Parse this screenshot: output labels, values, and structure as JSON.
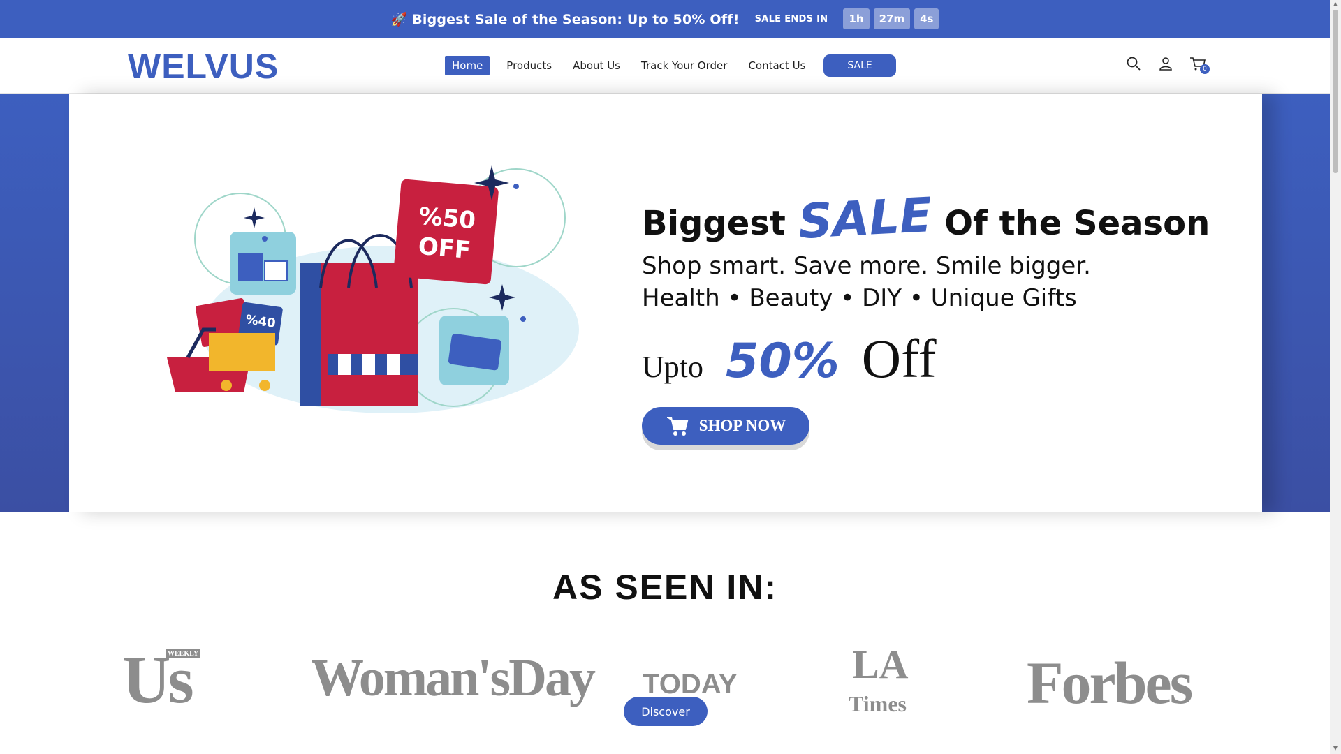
{
  "announcement": {
    "text": "🚀 Biggest Sale of the Season: Up to 50% Off!",
    "countdown_label": "SALE ENDS IN",
    "hours": "1h",
    "minutes": "27m",
    "seconds": "4s"
  },
  "header": {
    "logo": "WELVUS",
    "nav": [
      {
        "label": "Home"
      },
      {
        "label": "Products"
      },
      {
        "label": "About Us"
      },
      {
        "label": "Track Your Order"
      },
      {
        "label": "Contact Us"
      }
    ],
    "sale_button": "SALE",
    "cart_count": "0",
    "icons": [
      "search-icon",
      "account-icon",
      "cart-icon"
    ]
  },
  "hero": {
    "title_before": "Biggest",
    "title_highlight": "SALE",
    "title_after": "Of the Season",
    "line1": "Shop smart. Save more. Smile bigger.",
    "line2": "Health • Beauty • DIY • Unique Gifts",
    "offer_prefix": "Upto",
    "offer_percent": "50%",
    "offer_suffix": "Off",
    "cta": "SHOP NOW",
    "tags": [
      "%50",
      "OFF",
      "%40"
    ]
  },
  "press": {
    "title": "AS SEEN IN:",
    "logos": [
      "Us",
      "WEEKLY",
      "Woman'sDay",
      "TODAY",
      "LA",
      "Times",
      "Forbes"
    ]
  },
  "discover_button": "Discover",
  "colors": {
    "brand": "#3d5fbf",
    "accent_red": "#c8203f",
    "accent_yellow": "#f2b62c"
  }
}
